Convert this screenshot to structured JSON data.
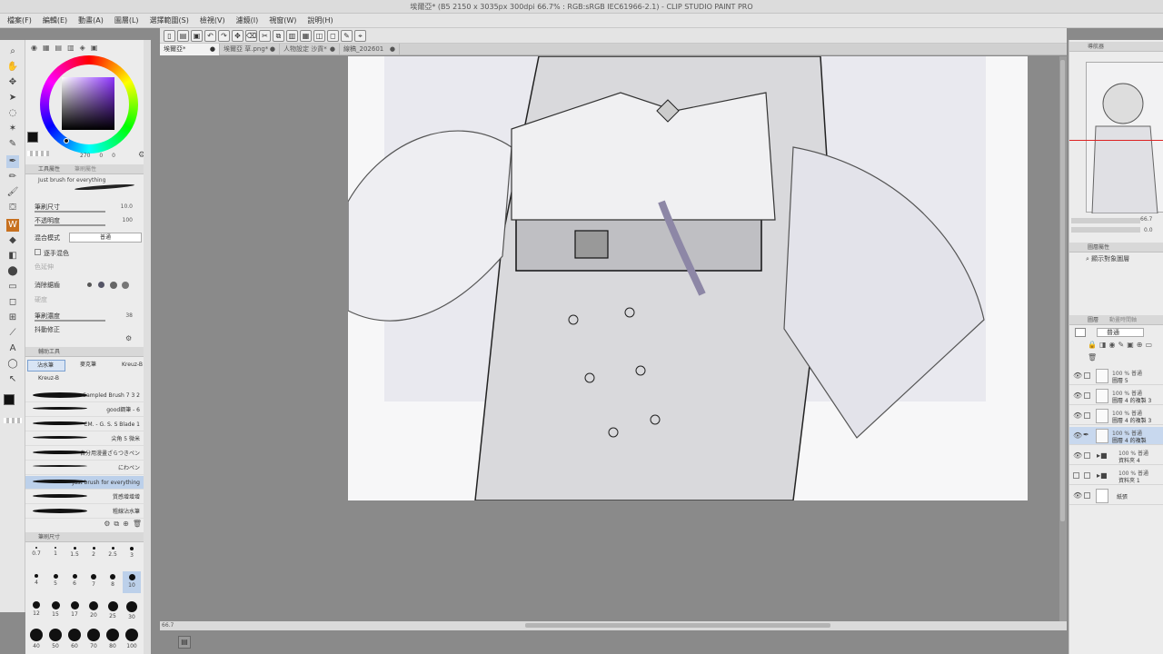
{
  "window": {
    "title": "埃爾亞* (B5 2150 x 3035px 300dpi 66.7% : RGB:sRGB IEC61966-2.1) - CLIP STUDIO PAINT PRO"
  },
  "menu": {
    "items": [
      "檔案(F)",
      "編輯(E)",
      "動畫(A)",
      "圖層(L)",
      "選擇範圍(S)",
      "檢視(V)",
      "濾鏡(I)",
      "視窗(W)",
      "說明(H)"
    ]
  },
  "tabs": [
    {
      "label": "埃爾亞*",
      "active": true
    },
    {
      "label": "埃爾亞 草.png*",
      "active": false
    },
    {
      "label": "人物設定 沙貢*",
      "active": false
    },
    {
      "label": "線稿_202601",
      "active": false
    }
  ],
  "color": {
    "hsv_readout": "270",
    "v1": "0",
    "v2": "0",
    "fg": "#111111",
    "bg": "#ffffff"
  },
  "tool_property": {
    "header": "工具屬性",
    "header2": "筆刷屬性",
    "brush_name": "Just brush for everything",
    "rows": [
      {
        "label": "筆刷尺寸",
        "value": "10.0"
      },
      {
        "label": "不透明度",
        "value": "100"
      },
      {
        "label": "混合模式",
        "value": "普通"
      },
      {
        "label": "逐手混色",
        "value": ""
      },
      {
        "label": "色延伸",
        "value": ""
      },
      {
        "label": "消除鋸齒",
        "value": ""
      },
      {
        "label": "硬度",
        "value": ""
      },
      {
        "label": "筆刷濃度",
        "value": "38"
      },
      {
        "label": "抖動修正",
        "value": ""
      }
    ]
  },
  "subtool": {
    "header": "輔助工具",
    "groups": [
      "沾水筆",
      "麥克筆",
      "Kreuz-B",
      "Kreuz-B"
    ],
    "items": [
      "Sampled Brush 7 3 2",
      "good鋼筆 - 6",
      "CM. - G. S. S Blade 1",
      "尖角 5 微米",
      "自分用漫畫ざらつきペン",
      "にわペン",
      "Just brush for everything",
      "質感增增增",
      "粗線沾水筆"
    ],
    "selected_index": 6
  },
  "brush_size": {
    "header": "筆刷尺寸",
    "sizes": [
      "0.7",
      "1",
      "1.5",
      "2",
      "2.5",
      "3",
      "4",
      "5",
      "6",
      "7",
      "8",
      "10",
      "12",
      "15",
      "17",
      "20",
      "25",
      "30",
      "40",
      "50",
      "60",
      "70",
      "80",
      "100"
    ],
    "selected": "10"
  },
  "navigator": {
    "header": "導航器",
    "zoom": "66.7",
    "angle": "0.0"
  },
  "layer_property": {
    "header": "圖層屬性",
    "show_label": "顯示對象圖層"
  },
  "layers": {
    "header": "圖層",
    "header2": "動畫時間軸",
    "blend_mode": "普通",
    "items": [
      {
        "l1": "100 % 普通",
        "l2": "圖層 5",
        "kind": "raster"
      },
      {
        "l1": "100 % 普通",
        "l2": "圖層 4 的複製 3",
        "kind": "raster"
      },
      {
        "l1": "100 % 普通",
        "l2": "圖層 4 的複製 3",
        "kind": "raster"
      },
      {
        "l1": "100 % 普通",
        "l2": "圖層 4 的複製",
        "kind": "raster",
        "selected": true
      },
      {
        "l1": "100 % 普通",
        "l2": "資料夾 4",
        "kind": "folder"
      },
      {
        "l1": "100 % 普通",
        "l2": "資料夾 1",
        "kind": "folder"
      },
      {
        "l1": "",
        "l2": "紙張",
        "kind": "paper"
      }
    ]
  },
  "canvas": {
    "zoom": "66.7",
    "status": "66.7"
  }
}
